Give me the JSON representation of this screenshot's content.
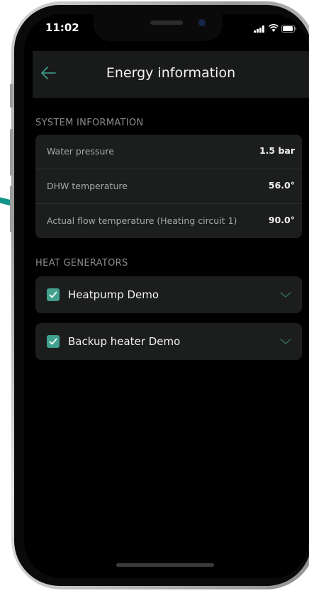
{
  "status_bar": {
    "time": "11:02"
  },
  "header": {
    "title": "Energy information",
    "back_icon": "arrow-left-icon"
  },
  "colors": {
    "accent": "#41a08e",
    "pointer_arrow": "#13968a",
    "background": "#000000",
    "card": "#1c1d1d",
    "header": "#191a1a"
  },
  "system_information": {
    "heading": "SYSTEM INFORMATION",
    "rows": [
      {
        "label": "Water pressure",
        "value": "1.5 bar"
      },
      {
        "label": "DHW temperature",
        "value": "56.0°"
      },
      {
        "label": "Actual flow temperature (Heating circuit 1)",
        "value": "90.0°"
      }
    ]
  },
  "heat_generators": {
    "heading": "HEAT GENERATORS",
    "items": [
      {
        "label": "Heatpump Demo",
        "checked": true,
        "expand_icon": "chevron-down-icon"
      },
      {
        "label": "Backup heater Demo",
        "checked": true,
        "expand_icon": "chevron-down-icon"
      }
    ]
  }
}
